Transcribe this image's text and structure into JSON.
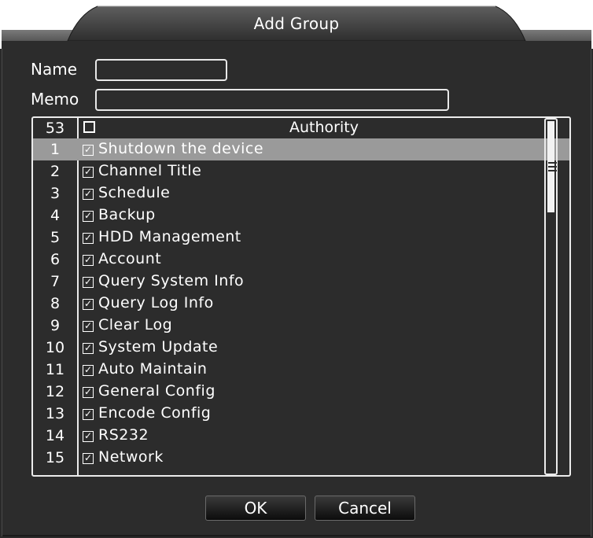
{
  "window": {
    "title": "Add Group"
  },
  "form": {
    "name_label": "Name",
    "name_value": "",
    "memo_label": "Memo",
    "memo_value": ""
  },
  "table": {
    "count": "53",
    "header": "Authority",
    "selected_index": 0,
    "rows": [
      {
        "num": "1",
        "label": "Shutdown the device",
        "checked": true
      },
      {
        "num": "2",
        "label": "Channel Title",
        "checked": true
      },
      {
        "num": "3",
        "label": "Schedule",
        "checked": true
      },
      {
        "num": "4",
        "label": "Backup",
        "checked": true
      },
      {
        "num": "5",
        "label": "HDD Management",
        "checked": true
      },
      {
        "num": "6",
        "label": "Account",
        "checked": true
      },
      {
        "num": "7",
        "label": "Query System Info",
        "checked": true
      },
      {
        "num": "8",
        "label": "Query Log Info",
        "checked": true
      },
      {
        "num": "9",
        "label": "Clear Log",
        "checked": true
      },
      {
        "num": "10",
        "label": "System Update",
        "checked": true
      },
      {
        "num": "11",
        "label": "Auto Maintain",
        "checked": true
      },
      {
        "num": "12",
        "label": "General Config",
        "checked": true
      },
      {
        "num": "13",
        "label": "Encode Config",
        "checked": true
      },
      {
        "num": "14",
        "label": "RS232",
        "checked": true
      },
      {
        "num": "15",
        "label": "Network",
        "checked": true
      }
    ]
  },
  "buttons": {
    "ok": "OK",
    "cancel": "Cancel"
  },
  "colors": {
    "background": "#2c2c2c",
    "selected_row": "#9a9a9a",
    "border": "#ececec"
  }
}
